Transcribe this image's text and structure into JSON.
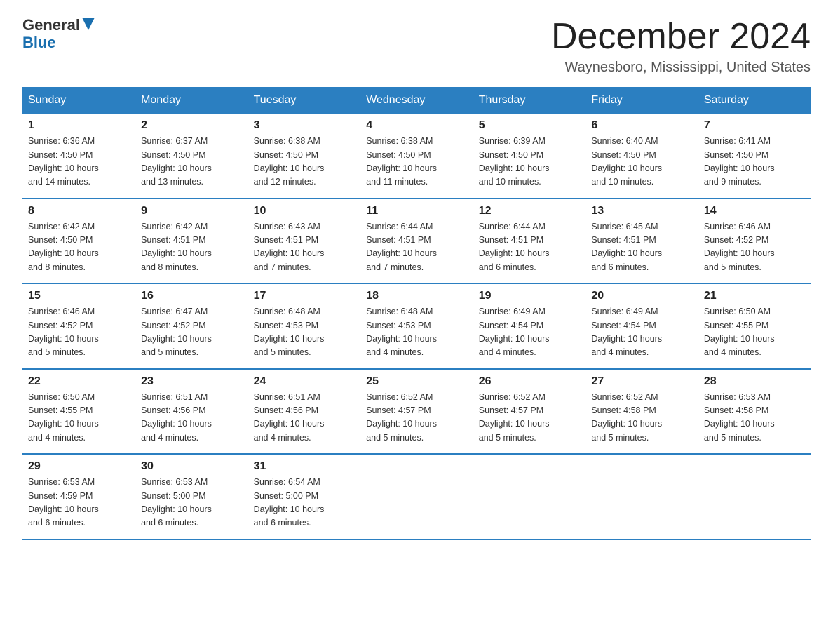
{
  "logo": {
    "text1": "General",
    "text2": "Blue"
  },
  "title": "December 2024",
  "location": "Waynesboro, Mississippi, United States",
  "days_of_week": [
    "Sunday",
    "Monday",
    "Tuesday",
    "Wednesday",
    "Thursday",
    "Friday",
    "Saturday"
  ],
  "weeks": [
    [
      {
        "day": "1",
        "sunrise": "6:36 AM",
        "sunset": "4:50 PM",
        "daylight": "10 hours and 14 minutes."
      },
      {
        "day": "2",
        "sunrise": "6:37 AM",
        "sunset": "4:50 PM",
        "daylight": "10 hours and 13 minutes."
      },
      {
        "day": "3",
        "sunrise": "6:38 AM",
        "sunset": "4:50 PM",
        "daylight": "10 hours and 12 minutes."
      },
      {
        "day": "4",
        "sunrise": "6:38 AM",
        "sunset": "4:50 PM",
        "daylight": "10 hours and 11 minutes."
      },
      {
        "day": "5",
        "sunrise": "6:39 AM",
        "sunset": "4:50 PM",
        "daylight": "10 hours and 10 minutes."
      },
      {
        "day": "6",
        "sunrise": "6:40 AM",
        "sunset": "4:50 PM",
        "daylight": "10 hours and 10 minutes."
      },
      {
        "day": "7",
        "sunrise": "6:41 AM",
        "sunset": "4:50 PM",
        "daylight": "10 hours and 9 minutes."
      }
    ],
    [
      {
        "day": "8",
        "sunrise": "6:42 AM",
        "sunset": "4:50 PM",
        "daylight": "10 hours and 8 minutes."
      },
      {
        "day": "9",
        "sunrise": "6:42 AM",
        "sunset": "4:51 PM",
        "daylight": "10 hours and 8 minutes."
      },
      {
        "day": "10",
        "sunrise": "6:43 AM",
        "sunset": "4:51 PM",
        "daylight": "10 hours and 7 minutes."
      },
      {
        "day": "11",
        "sunrise": "6:44 AM",
        "sunset": "4:51 PM",
        "daylight": "10 hours and 7 minutes."
      },
      {
        "day": "12",
        "sunrise": "6:44 AM",
        "sunset": "4:51 PM",
        "daylight": "10 hours and 6 minutes."
      },
      {
        "day": "13",
        "sunrise": "6:45 AM",
        "sunset": "4:51 PM",
        "daylight": "10 hours and 6 minutes."
      },
      {
        "day": "14",
        "sunrise": "6:46 AM",
        "sunset": "4:52 PM",
        "daylight": "10 hours and 5 minutes."
      }
    ],
    [
      {
        "day": "15",
        "sunrise": "6:46 AM",
        "sunset": "4:52 PM",
        "daylight": "10 hours and 5 minutes."
      },
      {
        "day": "16",
        "sunrise": "6:47 AM",
        "sunset": "4:52 PM",
        "daylight": "10 hours and 5 minutes."
      },
      {
        "day": "17",
        "sunrise": "6:48 AM",
        "sunset": "4:53 PM",
        "daylight": "10 hours and 5 minutes."
      },
      {
        "day": "18",
        "sunrise": "6:48 AM",
        "sunset": "4:53 PM",
        "daylight": "10 hours and 4 minutes."
      },
      {
        "day": "19",
        "sunrise": "6:49 AM",
        "sunset": "4:54 PM",
        "daylight": "10 hours and 4 minutes."
      },
      {
        "day": "20",
        "sunrise": "6:49 AM",
        "sunset": "4:54 PM",
        "daylight": "10 hours and 4 minutes."
      },
      {
        "day": "21",
        "sunrise": "6:50 AM",
        "sunset": "4:55 PM",
        "daylight": "10 hours and 4 minutes."
      }
    ],
    [
      {
        "day": "22",
        "sunrise": "6:50 AM",
        "sunset": "4:55 PM",
        "daylight": "10 hours and 4 minutes."
      },
      {
        "day": "23",
        "sunrise": "6:51 AM",
        "sunset": "4:56 PM",
        "daylight": "10 hours and 4 minutes."
      },
      {
        "day": "24",
        "sunrise": "6:51 AM",
        "sunset": "4:56 PM",
        "daylight": "10 hours and 4 minutes."
      },
      {
        "day": "25",
        "sunrise": "6:52 AM",
        "sunset": "4:57 PM",
        "daylight": "10 hours and 5 minutes."
      },
      {
        "day": "26",
        "sunrise": "6:52 AM",
        "sunset": "4:57 PM",
        "daylight": "10 hours and 5 minutes."
      },
      {
        "day": "27",
        "sunrise": "6:52 AM",
        "sunset": "4:58 PM",
        "daylight": "10 hours and 5 minutes."
      },
      {
        "day": "28",
        "sunrise": "6:53 AM",
        "sunset": "4:58 PM",
        "daylight": "10 hours and 5 minutes."
      }
    ],
    [
      {
        "day": "29",
        "sunrise": "6:53 AM",
        "sunset": "4:59 PM",
        "daylight": "10 hours and 6 minutes."
      },
      {
        "day": "30",
        "sunrise": "6:53 AM",
        "sunset": "5:00 PM",
        "daylight": "10 hours and 6 minutes."
      },
      {
        "day": "31",
        "sunrise": "6:54 AM",
        "sunset": "5:00 PM",
        "daylight": "10 hours and 6 minutes."
      },
      null,
      null,
      null,
      null
    ]
  ],
  "labels": {
    "sunrise": "Sunrise:",
    "sunset": "Sunset:",
    "daylight": "Daylight:"
  }
}
